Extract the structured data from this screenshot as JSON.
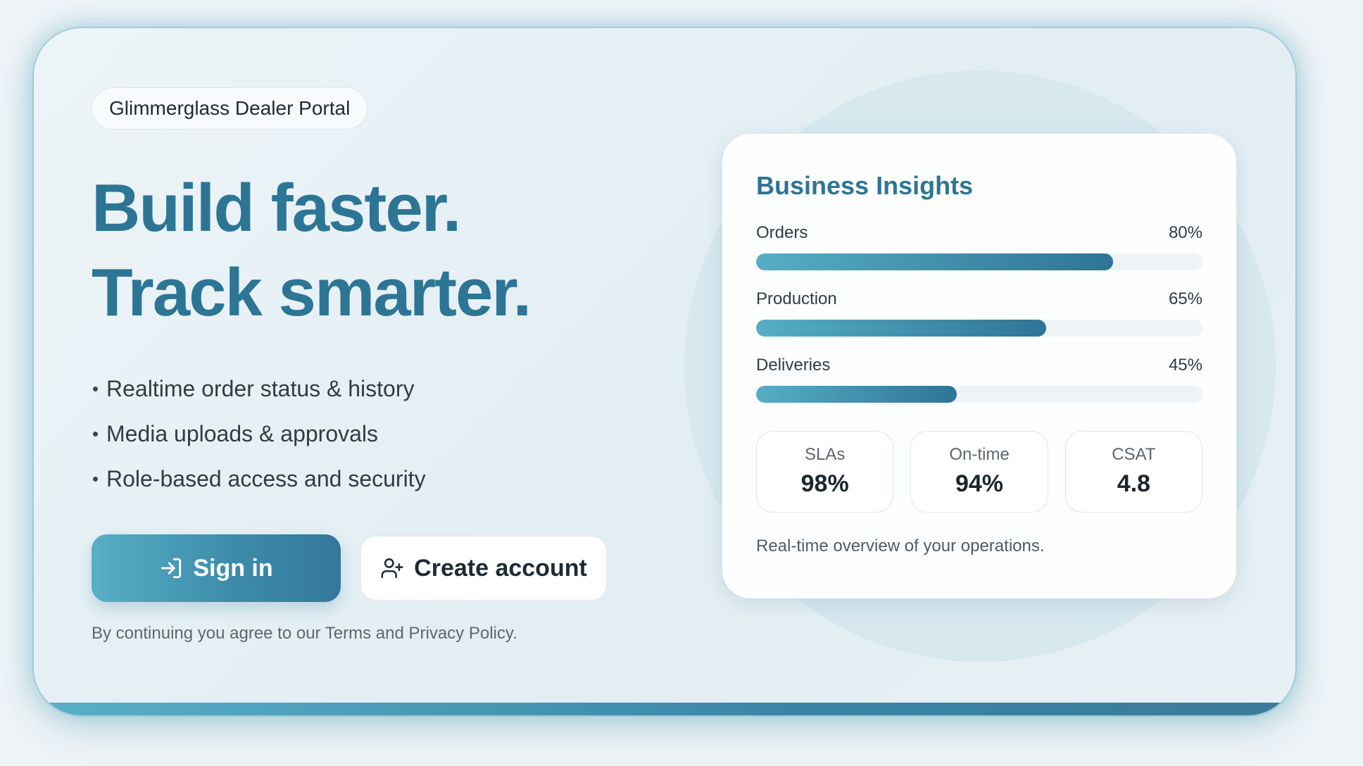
{
  "portal": {
    "name": "Glimmerglass Dealer Portal"
  },
  "hero": {
    "line1": "Build faster.",
    "line2": "Track smarter."
  },
  "features": [
    "Realtime order status & history",
    "Media uploads & approvals",
    "Role-based access and security"
  ],
  "actions": {
    "signin_label": "Sign in",
    "signin_icon": "sign-in-icon",
    "create_label": "Create account",
    "create_icon": "user-plus-icon"
  },
  "terms": "By continuing you agree to our Terms and Privacy Policy.",
  "insights": {
    "title": "Business Insights",
    "metrics": [
      {
        "label": "Orders",
        "value_text": "80%",
        "value": 0.8
      },
      {
        "label": "Production",
        "value_text": "65%",
        "value": 0.65
      },
      {
        "label": "Deliveries",
        "value_text": "45%",
        "value": 0.45
      }
    ],
    "stats": [
      {
        "label": "SLAs",
        "value": "98%"
      },
      {
        "label": "On-time",
        "value": "94%"
      },
      {
        "label": "CSAT",
        "value": "4.8"
      }
    ],
    "caption": "Real-time overview of your operations."
  },
  "colors": {
    "accent": "#2c7595",
    "accent_light": "#56aec5"
  }
}
